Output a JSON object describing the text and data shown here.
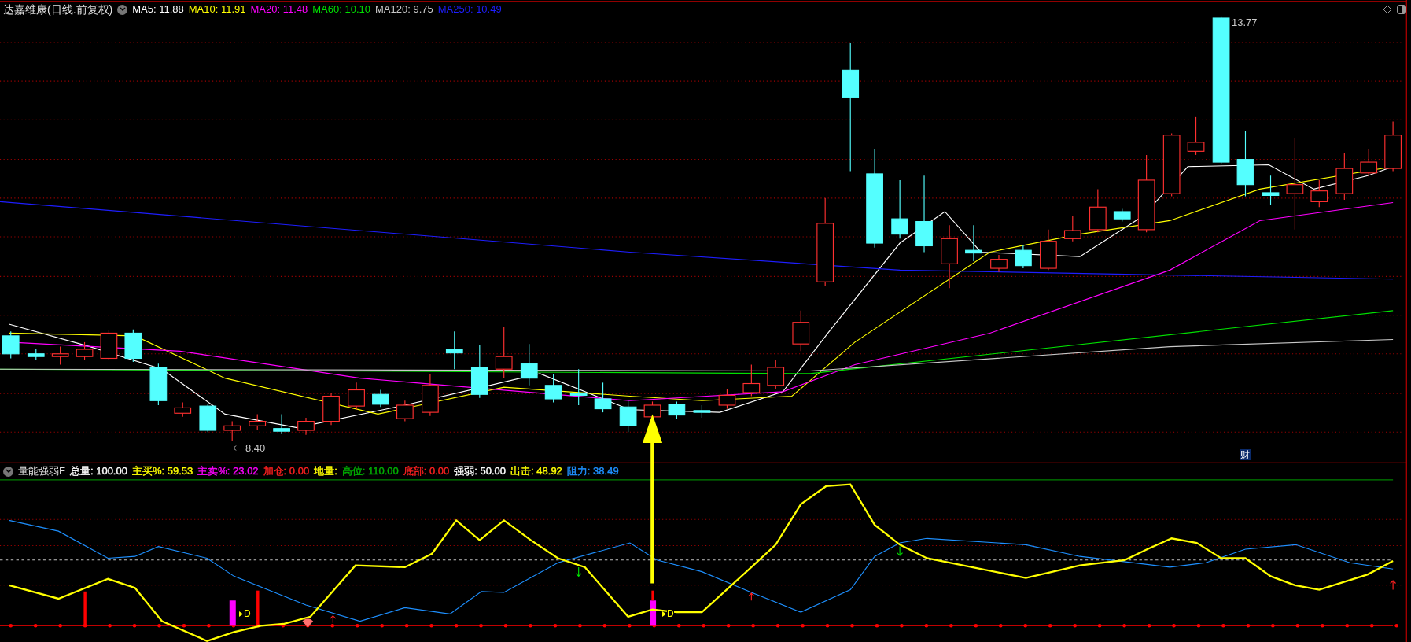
{
  "price_panel": {
    "title": "达嘉维康(日线.前复权)",
    "ma_legend": [
      {
        "text": "MA5: 11.88",
        "color": "#ffffff"
      },
      {
        "text": "MA10: 11.91",
        "color": "#ffff00"
      },
      {
        "text": "MA20: 11.48",
        "color": "#ff00ff"
      },
      {
        "text": "MA60: 10.10",
        "color": "#00e000"
      },
      {
        "text": "MA120: 9.75",
        "color": "#c8c8c8"
      },
      {
        "text": "MA250: 10.49",
        "color": "#1e1eff"
      }
    ],
    "high_label": "13.77",
    "low_label": "8.40",
    "finance_marker": "财"
  },
  "indicator_panel": {
    "title": "量能强弱F",
    "legend": [
      {
        "text": "总量: 100.00",
        "color": "#ffffff"
      },
      {
        "text": "主买%: 59.53",
        "color": "#ffff00"
      },
      {
        "text": "主卖%: 23.02",
        "color": "#ff00ff"
      },
      {
        "text": "加仓: 0.00",
        "color": "#ff2020"
      },
      {
        "text": "地量:",
        "color": "#ffff00"
      },
      {
        "text": "高位: 110.00",
        "color": "#00b000"
      },
      {
        "text": "底部: 0.00",
        "color": "#ff2020"
      },
      {
        "text": "强弱: 50.00",
        "color": "#ffffff"
      },
      {
        "text": "出击: 48.92",
        "color": "#ffff00"
      },
      {
        "text": "阻力: 38.49",
        "color": "#1e90ff"
      }
    ],
    "signals": [
      {
        "label": "D"
      },
      {
        "label": "D"
      }
    ]
  }
}
